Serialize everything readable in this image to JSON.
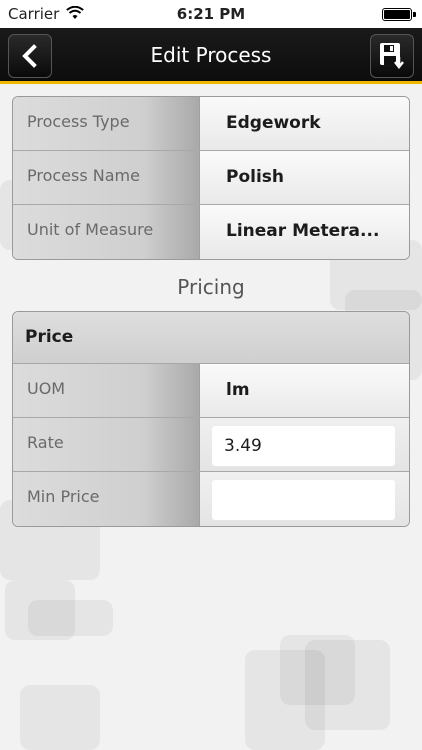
{
  "status_bar": {
    "carrier": "Carrier",
    "time": "6:21 PM"
  },
  "nav": {
    "title": "Edit Process",
    "back_icon": "chevron-left-icon",
    "save_icon": "save-floppy-icon",
    "accent_color": "#f0b800"
  },
  "process": {
    "rows": [
      {
        "label": "Process Type",
        "value": "Edgework"
      },
      {
        "label": "Process Name",
        "value": "Polish"
      },
      {
        "label": "Unit of Measure",
        "value": "Linear Metera..."
      }
    ]
  },
  "pricing": {
    "section_title": "Pricing",
    "header": "Price",
    "uom_label": "UOM",
    "uom_value": "lm",
    "rate_label": "Rate",
    "rate_value": "3.49",
    "min_price_label": "Min Price",
    "min_price_value": ""
  }
}
